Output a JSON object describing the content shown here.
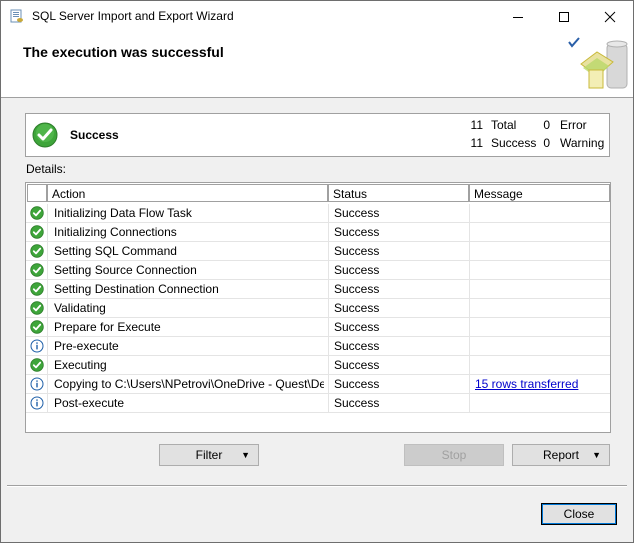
{
  "window": {
    "title": "SQL Server Import and Export Wizard",
    "controls": [
      "minimize-icon",
      "maximize-icon",
      "close-icon"
    ]
  },
  "banner": {
    "title": "The execution was successful"
  },
  "summary": {
    "status": "Success",
    "total_count": "11",
    "total_label": "Total",
    "success_count": "11",
    "success_label": "Success",
    "error_count": "0",
    "error_label": "Error",
    "warning_count": "0",
    "warning_label": "Warning"
  },
  "details": {
    "label": "Details:",
    "columns": [
      "Action",
      "Status",
      "Message"
    ],
    "rows": [
      {
        "icon": "success-icon",
        "action": "Initializing Data Flow Task",
        "status": "Success",
        "message": ""
      },
      {
        "icon": "success-icon",
        "action": "Initializing Connections",
        "status": "Success",
        "message": ""
      },
      {
        "icon": "success-icon",
        "action": "Setting SQL Command",
        "status": "Success",
        "message": ""
      },
      {
        "icon": "success-icon",
        "action": "Setting Source Connection",
        "status": "Success",
        "message": ""
      },
      {
        "icon": "success-icon",
        "action": "Setting Destination Connection",
        "status": "Success",
        "message": ""
      },
      {
        "icon": "success-icon",
        "action": "Validating",
        "status": "Success",
        "message": ""
      },
      {
        "icon": "success-icon",
        "action": "Prepare for Execute",
        "status": "Success",
        "message": ""
      },
      {
        "icon": "info-icon",
        "action": "Pre-execute",
        "status": "Success",
        "message": ""
      },
      {
        "icon": "success-icon",
        "action": "Executing",
        "status": "Success",
        "message": ""
      },
      {
        "icon": "info-icon",
        "action": "Copying to C:\\Users\\NPetrovi\\OneDrive - Quest\\Des...",
        "status": "Success",
        "message": "15 rows transferred"
      },
      {
        "icon": "info-icon",
        "action": "Post-execute",
        "status": "Success",
        "message": ""
      }
    ]
  },
  "buttons": {
    "filter": "Filter",
    "stop": "Stop",
    "report": "Report",
    "close": "Close"
  },
  "colors": {
    "success_green": "#3ea53a",
    "info_blue": "#1e5fa8",
    "link": "#0000cc"
  }
}
